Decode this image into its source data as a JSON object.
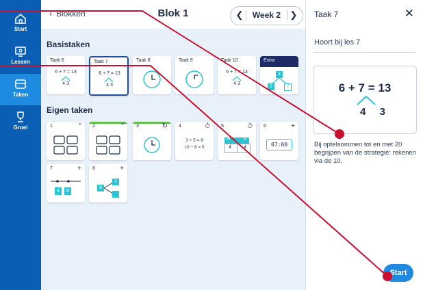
{
  "sidebar": {
    "items": [
      {
        "label": "Start",
        "icon": "home-icon"
      },
      {
        "label": "Lessen",
        "icon": "lessons-icon"
      },
      {
        "label": "Taken",
        "icon": "tasks-icon"
      },
      {
        "label": "Groei",
        "icon": "trophy-icon"
      }
    ]
  },
  "header": {
    "back_label": "Blokken",
    "title": "Blok 1",
    "week_label": "Week 2"
  },
  "basistaken": {
    "heading": "Basistaken",
    "cards": [
      {
        "title": "Taak 6",
        "eq": "6 + 7 = 13",
        "split": "4  3"
      },
      {
        "title": "Taak 7",
        "eq": "6 + 7 = 13",
        "split": "4  3"
      },
      {
        "title": "Taak 8"
      },
      {
        "title": "Taak 9"
      },
      {
        "title": "Taak 10",
        "eq": "6 + 7 = 13",
        "split": "4  3"
      },
      {
        "title": "Extra",
        "top": "8",
        "left": "2",
        "right": "7"
      }
    ]
  },
  "eigen": {
    "heading": "Eigen taken",
    "cards": [
      {
        "num": "1"
      },
      {
        "num": "2"
      },
      {
        "num": "3"
      },
      {
        "num": "4",
        "eq1": "3 + 5 = 8",
        "eq2": "10 − 8 = 5"
      },
      {
        "num": "5",
        "h": "H",
        "e": "E",
        "a": "4",
        "b": "4"
      },
      {
        "num": "6",
        "time": "07:00"
      },
      {
        "num": "7",
        "a": "4",
        "b": "6"
      },
      {
        "num": "8",
        "a": "8",
        "b": "2"
      }
    ]
  },
  "panel": {
    "title": "Taak 7",
    "close": "✕",
    "subtitle": "Hoort bij les 7",
    "formula": "6 + 7 = 13",
    "split": "4 3",
    "description": "Bij optelsommen tot en met 20 begrijpen van de strategie: rekenen via de 10.",
    "start_label": "Start"
  },
  "colors": {
    "sidebar": "#0a5fb5",
    "accent": "#1f8be0",
    "annotation": "#c8102e",
    "teal": "#2cc3d2",
    "green": "#63c04f"
  }
}
